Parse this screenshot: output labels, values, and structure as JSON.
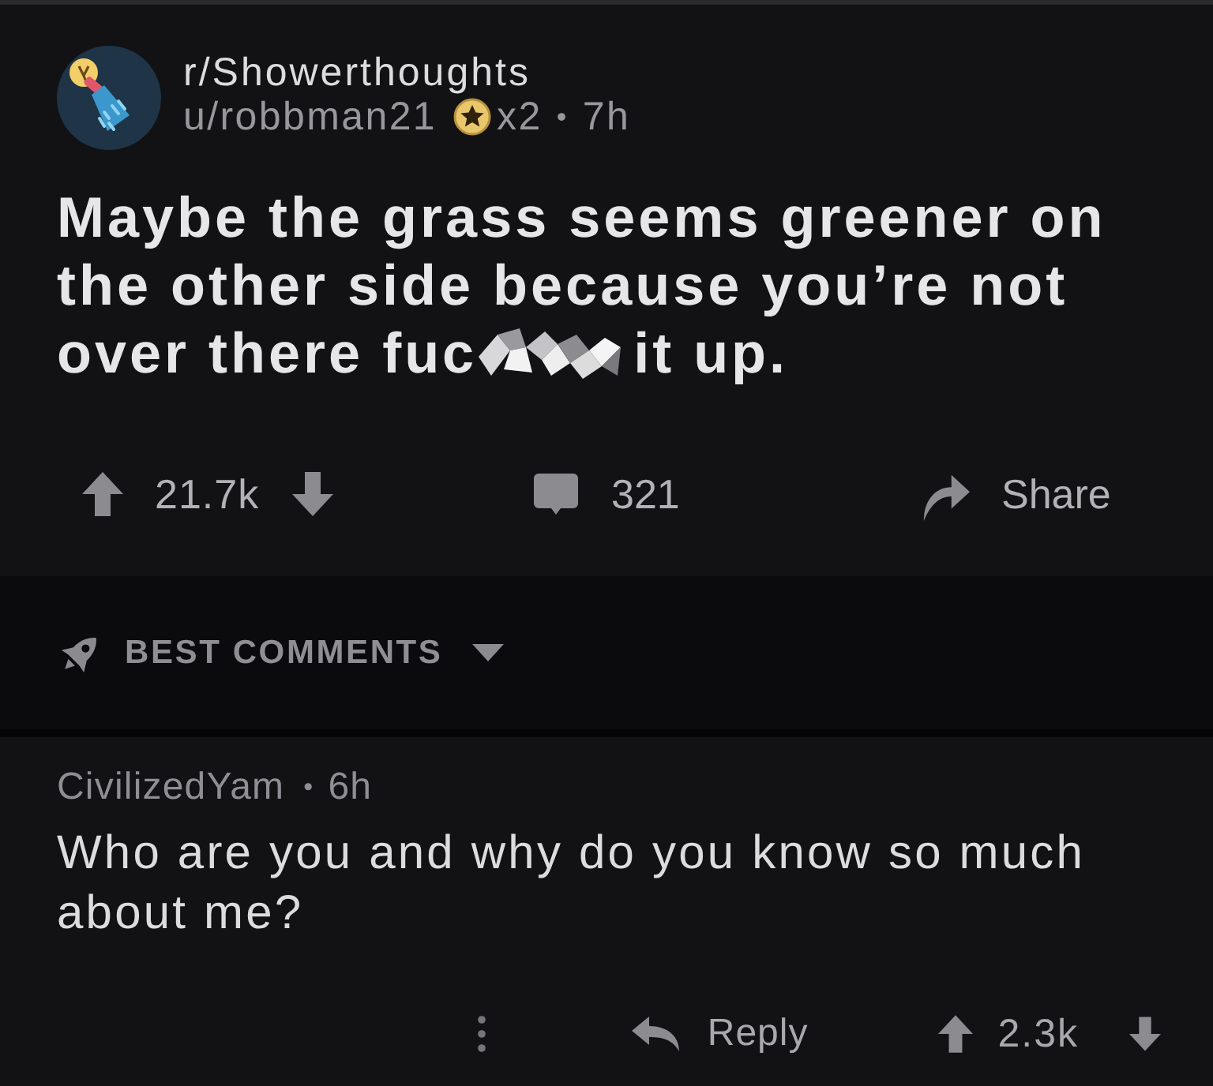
{
  "post": {
    "subreddit": "r/Showerthoughts",
    "author": "u/robbman21",
    "award_count": "x2",
    "separator": "•",
    "age": "7h",
    "title": {
      "text": "Maybe the grass seems greener on the other side because you’re not",
      "censored_line": {
        "before": "over there fuc",
        "after": "it up."
      }
    },
    "score": "21.7k",
    "comment_count": "321",
    "share_label": "Share"
  },
  "comment_sort": {
    "label": "BEST COMMENTS"
  },
  "comments": [
    {
      "author": "CivilizedYam",
      "separator": "•",
      "age": "6h",
      "body": "Who are you and why do you know so much about me?",
      "reply_label": "Reply",
      "score": "2.3k"
    }
  ]
}
